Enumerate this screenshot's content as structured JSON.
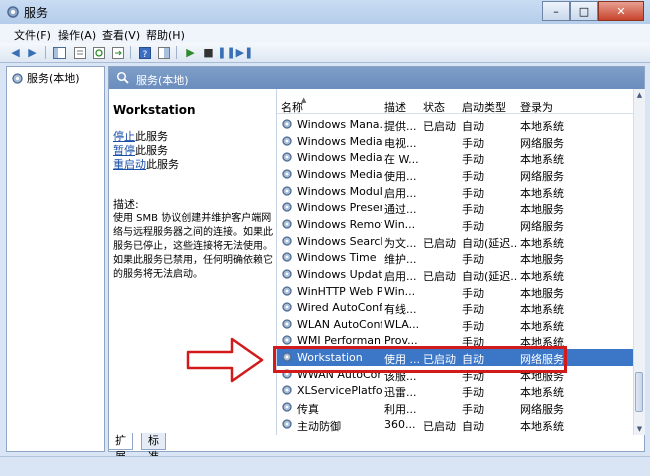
{
  "window": {
    "title": "服务",
    "minimize": "–",
    "maximize": "□",
    "close": "✕"
  },
  "menu": [
    "文件(F)",
    "操作(A)",
    "查看(V)",
    "帮助(H)"
  ],
  "tree": {
    "item": "服务(本地)"
  },
  "header": {
    "title": "服务(本地)"
  },
  "detail": {
    "service_name": "Workstation",
    "actions": [
      {
        "link": "停止",
        "suffix": "此服务"
      },
      {
        "link": "暂停",
        "suffix": "此服务"
      },
      {
        "link": "重启动",
        "suffix": "此服务"
      }
    ],
    "description_label": "描述:",
    "description": "使用 SMB 协议创建并维护客户端网络与远程服务器之间的连接。如果此服务已停止，这些连接将无法使用。如果此服务已禁用，任何明确依赖它的服务将无法启动。"
  },
  "columns": [
    "名称",
    "描述",
    "状态",
    "启动类型",
    "登录为"
  ],
  "rows": [
    [
      "Windows Mana...",
      "提供...",
      "已启动",
      "自动",
      "本地系统"
    ],
    [
      "Windows Media...",
      "电视...",
      "",
      "手动",
      "网络服务"
    ],
    [
      "Windows Media...",
      "在 W...",
      "",
      "手动",
      "本地系统"
    ],
    [
      "Windows Media...",
      "使用...",
      "",
      "手动",
      "网络服务"
    ],
    [
      "Windows Modul...",
      "启用...",
      "",
      "手动",
      "本地系统"
    ],
    [
      "Windows Presen...",
      "通过...",
      "",
      "手动",
      "本地服务"
    ],
    [
      "Windows Remot...",
      "Win...",
      "",
      "手动",
      "网络服务"
    ],
    [
      "Windows Search",
      "为文...",
      "已启动",
      "自动(延迟...",
      "本地系统"
    ],
    [
      "Windows Time",
      "维护...",
      "",
      "手动",
      "本地服务"
    ],
    [
      "Windows Update",
      "启用...",
      "已启动",
      "自动(延迟...",
      "本地系统"
    ],
    [
      "WinHTTP Web P...",
      "Win...",
      "",
      "手动",
      "本地服务"
    ],
    [
      "Wired AutoConfig",
      "有线...",
      "",
      "手动",
      "本地系统"
    ],
    [
      "WLAN AutoConfig",
      "WLA...",
      "",
      "手动",
      "本地系统"
    ],
    [
      "WMI Performan...",
      "Prov...",
      "",
      "手动",
      "本地系统"
    ],
    [
      "Workstation",
      "使用 ...",
      "已启动",
      "自动",
      "网络服务"
    ],
    [
      "WWAN AutoConfi...",
      "该服...",
      "",
      "手动",
      "本地服务"
    ],
    [
      "XLServicePlatform",
      "迅雷...",
      "",
      "手动",
      "本地系统"
    ],
    [
      "传真",
      "利用...",
      "",
      "手动",
      "网络服务"
    ],
    [
      "主动防御",
      "360...",
      "已启动",
      "自动",
      "本地系统"
    ]
  ],
  "selected_row": "Workstation",
  "tabs": [
    "扩展",
    "标准"
  ],
  "colors": {
    "highlight": "#d21a1a",
    "selection": "#3c76c7",
    "header": "#6a8dbe"
  }
}
